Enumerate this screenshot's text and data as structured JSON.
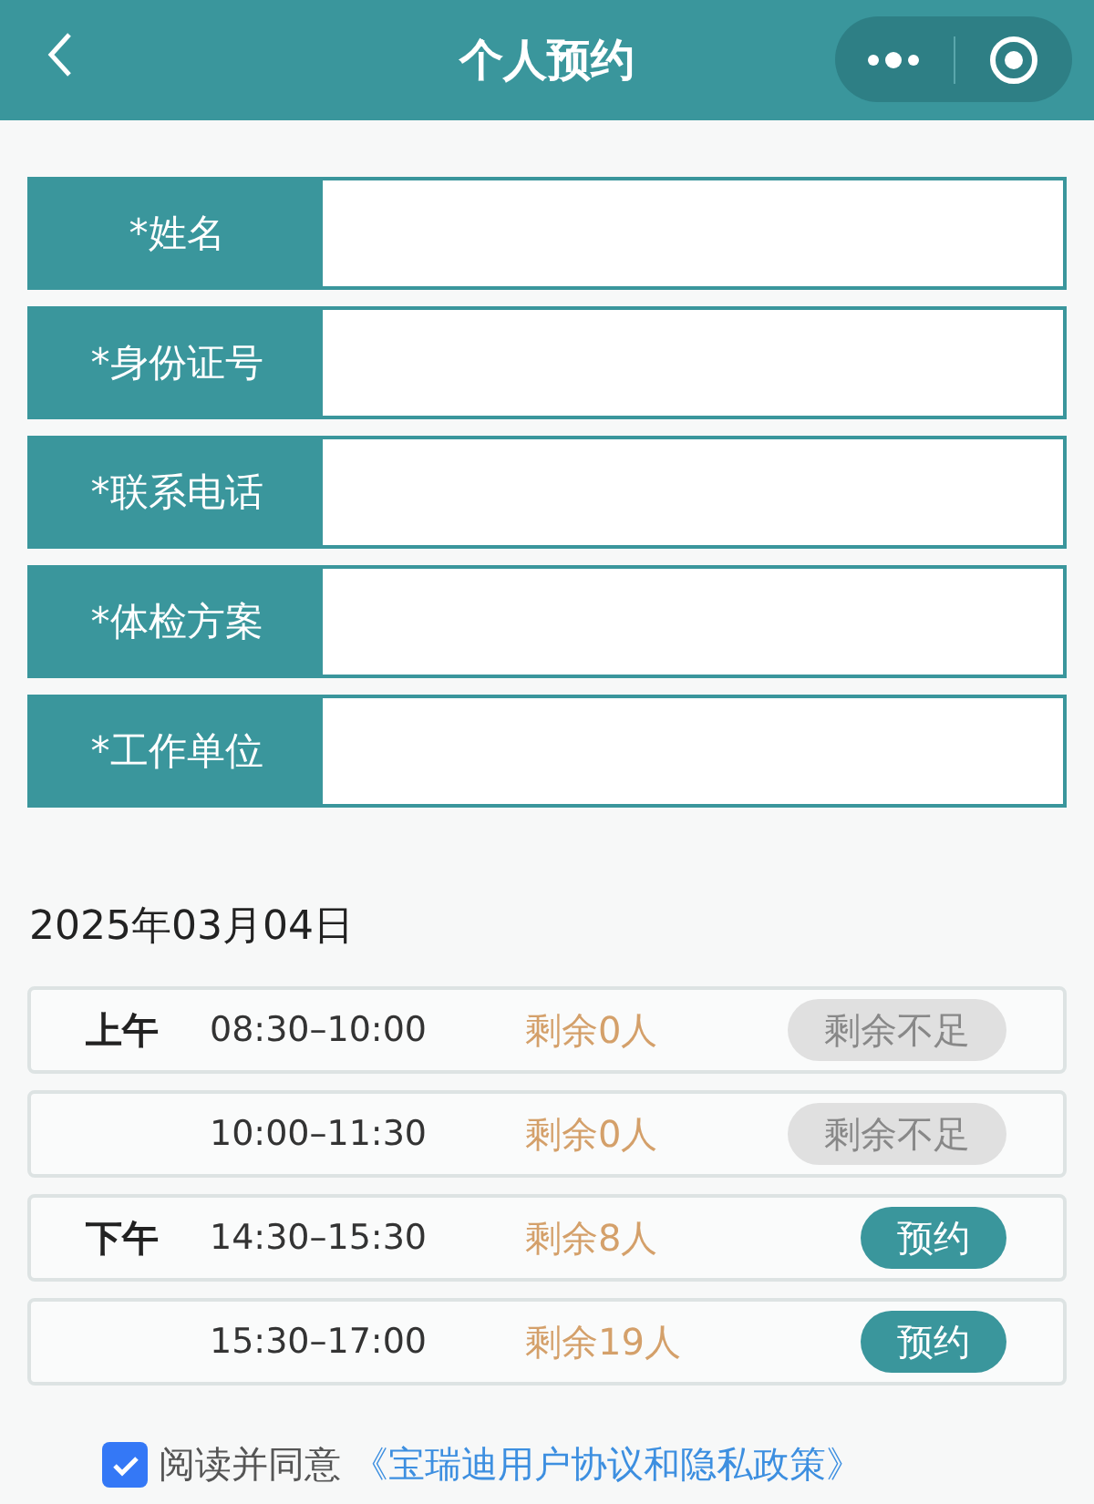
{
  "header": {
    "title": "个人预约"
  },
  "fields": [
    {
      "label": "*姓名"
    },
    {
      "label": "*身份证号"
    },
    {
      "label": "*联系电话"
    },
    {
      "label": "*体检方案"
    },
    {
      "label": "*工作单位"
    }
  ],
  "date": "2025年03月04日",
  "slots": [
    {
      "period": "上午",
      "time": "08:30–10:00",
      "remaining": "剩余0人",
      "action": "剩余不足",
      "disabled": true
    },
    {
      "time": "10:00–11:30",
      "remaining": "剩余0人",
      "action": "剩余不足",
      "disabled": true
    },
    {
      "period": "下午",
      "time": "14:30–15:30",
      "remaining": "剩余8人",
      "action": "预约",
      "disabled": false
    },
    {
      "time": "15:30–17:00",
      "remaining": "剩余19人",
      "action": "预约",
      "disabled": false
    }
  ],
  "agreement": {
    "checked": true,
    "text": "阅读并同意",
    "link": "《宝瑞迪用户协议和隐私政策》"
  }
}
